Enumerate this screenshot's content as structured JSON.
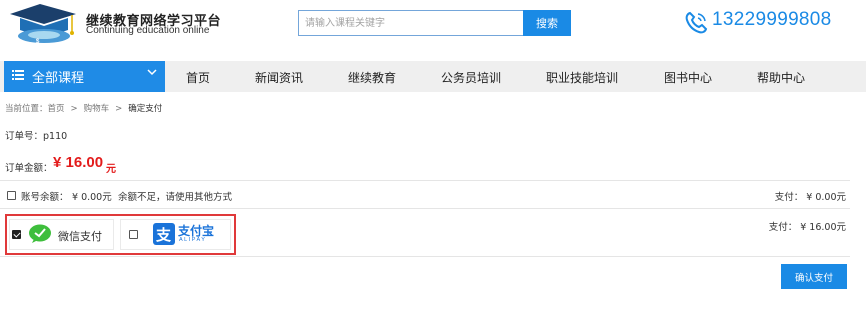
{
  "header": {
    "site_title": "继续教育网络学习平台",
    "site_subtitle": "Continuing education online",
    "search_placeholder": "请输入课程关键字",
    "search_button": "搜索",
    "phone": "13229999808"
  },
  "nav": {
    "all_courses": "全部课程",
    "items": [
      {
        "label": "首页"
      },
      {
        "label": "新闻资讯"
      },
      {
        "label": "继续教育"
      },
      {
        "label": "公务员培训"
      },
      {
        "label": "职业技能培训"
      },
      {
        "label": "图书中心"
      },
      {
        "label": "帮助中心"
      }
    ]
  },
  "breadcrumb": {
    "prefix": "当前位置：",
    "items": [
      "首页",
      "购物车",
      "确定支付"
    ],
    "separator": ">"
  },
  "order": {
    "number_label": "订单号：p110",
    "amount_label": "订单金额：",
    "amount_value": "¥ 16.00",
    "amount_unit": "元"
  },
  "balance": {
    "checked": false,
    "label": "账号余额：",
    "amount": "¥ 0.00元",
    "note": "余额不足，请使用其他方式",
    "pay_text": "支付：  ¥ 0.00元"
  },
  "payment": {
    "wechat": {
      "checked": true,
      "label": "微信支付"
    },
    "alipay": {
      "checked": false,
      "label_cn": "支付宝",
      "label_en": "ALIPAY"
    },
    "pay_text": "支付：  ¥ 16.00元"
  },
  "confirm_button": "确认支付",
  "colors": {
    "primary": "#1a8ae5",
    "price_red": "#e31b1b",
    "highlight_border": "#e0393a",
    "wechat_green": "#3ebe3c",
    "nav_bg": "#efefef"
  }
}
